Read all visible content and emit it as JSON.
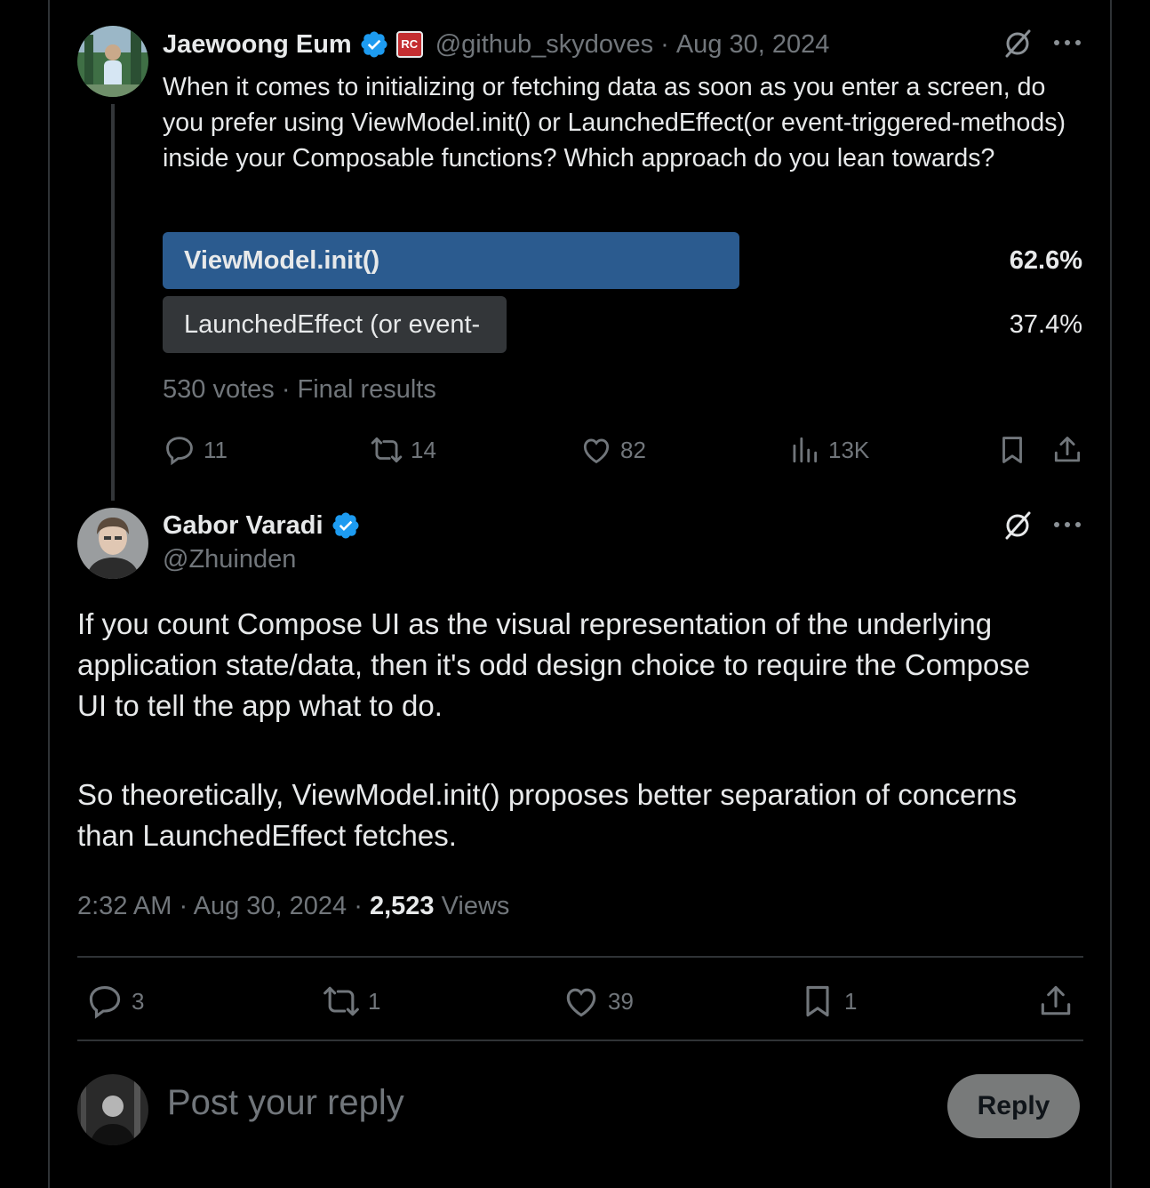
{
  "original_post": {
    "author_name": "Jaewoong Eum",
    "handle": "@github_skydoves",
    "date": "Aug 30, 2024",
    "badge_text": "RC",
    "text": "When it comes to initializing or fetching data as soon as you enter a screen, do you prefer using ViewModel.init() or LaunchedEffect(or event-triggered-methods) inside your Composable functions? Which approach do you lean towards?",
    "poll": {
      "options": [
        {
          "label": "ViewModel.init()",
          "percent": "62.6%",
          "fraction": 0.626,
          "winner": true
        },
        {
          "label": "LaunchedEffect (or event-",
          "percent": "37.4%",
          "fraction": 0.374,
          "winner": false
        }
      ],
      "footer": "530 votes · Final results"
    },
    "actions": {
      "replies": "11",
      "reposts": "14",
      "likes": "82",
      "views": "13K"
    }
  },
  "reply_post": {
    "author_name": "Gabor Varadi",
    "handle": "@Zhuinden",
    "paragraph_1": "If you count Compose UI as the visual representation of the underlying application state/data, then it's odd design choice to require the Compose UI to tell the app what to do.",
    "paragraph_2": "So theoretically, ViewModel.init() proposes better separation of concerns than LaunchedEffect fetches.",
    "time": "2:32 AM",
    "date": "Aug 30, 2024",
    "views_count": "2,523",
    "views_label": "Views",
    "actions": {
      "replies": "3",
      "reposts": "1",
      "likes": "39",
      "bookmarks": "1"
    }
  },
  "composer": {
    "placeholder": "Post your reply",
    "reply_button": "Reply"
  },
  "colors": {
    "background": "#000000",
    "poll_winner": "#2b5b8f",
    "poll_other": "#333639",
    "verified": "#1d9bf0",
    "muted": "#71767b"
  },
  "icons": [
    "grok-icon",
    "more-icon",
    "reply-icon",
    "repost-icon",
    "like-icon",
    "views-icon",
    "bookmark-icon",
    "share-icon",
    "verified-icon"
  ]
}
